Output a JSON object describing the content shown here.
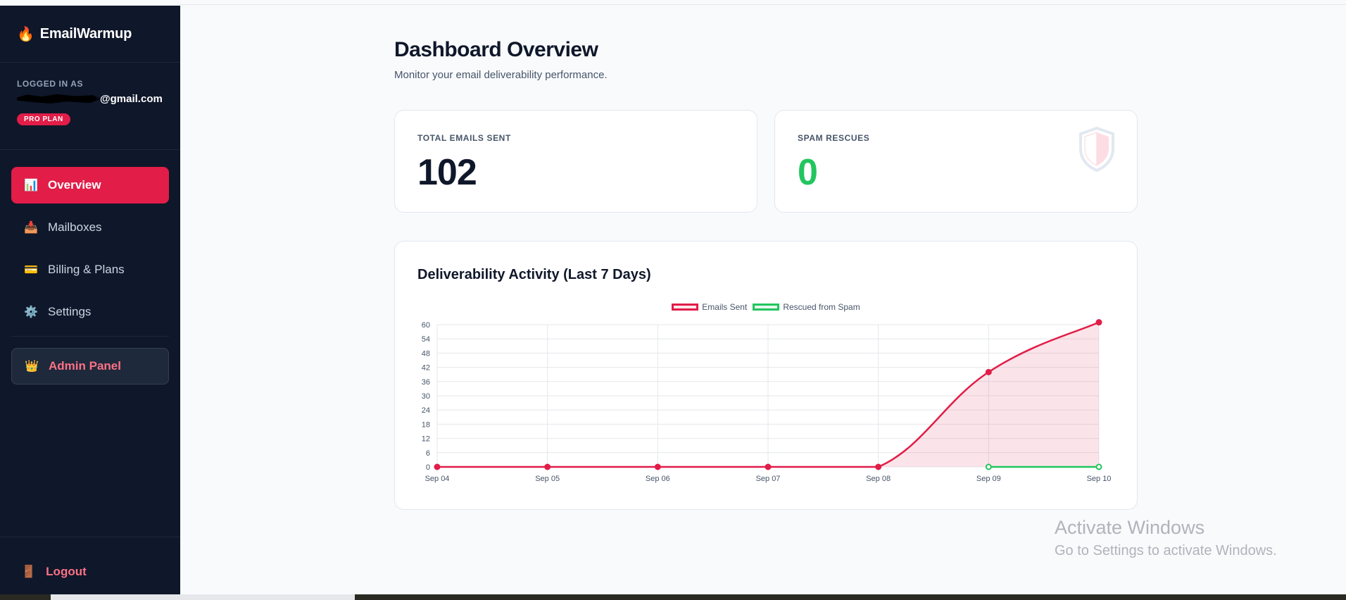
{
  "app": {
    "brand": "EmailWarmup",
    "brand_icon": "flame-icon"
  },
  "user": {
    "logged_in_label": "LOGGED IN AS",
    "email_visible": "@gmail.com",
    "plan_badge": "PRO PLAN"
  },
  "sidebar": {
    "items": [
      {
        "label": "Overview",
        "icon": "bar-chart-icon",
        "active": true
      },
      {
        "label": "Mailboxes",
        "icon": "inbox-tray-icon"
      },
      {
        "label": "Billing & Plans",
        "icon": "credit-card-icon"
      },
      {
        "label": "Settings",
        "icon": "gear-icon"
      }
    ],
    "admin": {
      "label": "Admin Panel",
      "icon": "crown-icon"
    },
    "logout": {
      "label": "Logout",
      "icon": "door-icon"
    }
  },
  "page": {
    "title": "Dashboard Overview",
    "subtitle": "Monitor your email deliverability performance."
  },
  "stats": {
    "emails_sent": {
      "label": "TOTAL EMAILS SENT",
      "value": "102"
    },
    "spam_rescues": {
      "label": "SPAM RESCUES",
      "value": "0",
      "icon": "shield-icon"
    }
  },
  "chart_card": {
    "title": "Deliverability Activity (Last 7 Days)"
  },
  "chart_data": {
    "type": "line",
    "title": "Deliverability Activity (Last 7 Days)",
    "x": [
      "Sep 04",
      "Sep 05",
      "Sep 06",
      "Sep 07",
      "Sep 08",
      "Sep 09",
      "Sep 10"
    ],
    "series": [
      {
        "name": "Emails Sent",
        "values": [
          0,
          0,
          0,
          0,
          0,
          40,
          61
        ],
        "color": "#e11d48",
        "fill": true
      },
      {
        "name": "Rescued from Spam",
        "values": [
          null,
          null,
          null,
          null,
          null,
          0,
          0
        ],
        "color": "#22c55e",
        "fill": false
      }
    ],
    "ylim": [
      0,
      60
    ],
    "yticks": [
      0,
      6,
      12,
      18,
      24,
      30,
      36,
      42,
      48,
      54,
      60
    ],
    "grid": true,
    "legend": "top-center"
  },
  "os_overlay": {
    "line1": "Activate Windows",
    "line2": "Go to Settings to activate Windows."
  },
  "colors": {
    "sidebar_bg": "#0f172a",
    "accent": "#e11d48",
    "success": "#22c55e"
  }
}
